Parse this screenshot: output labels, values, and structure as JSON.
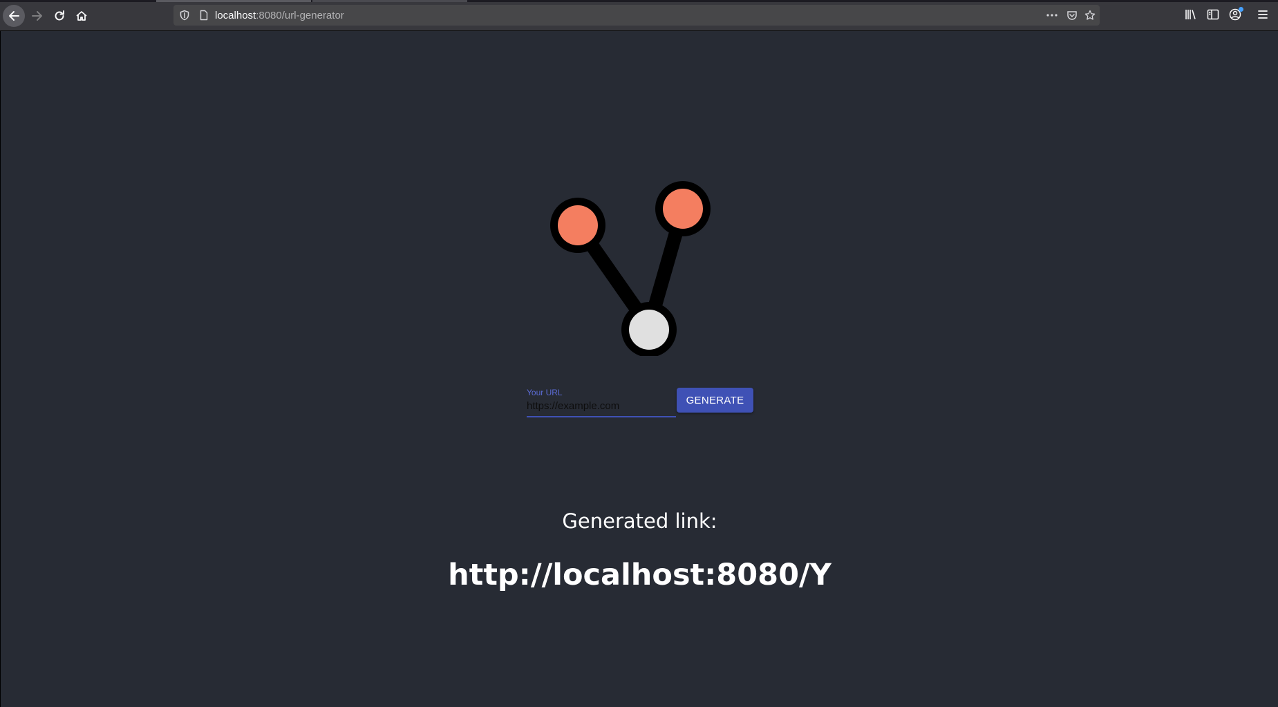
{
  "browser": {
    "url_host": "localhost",
    "url_rest": ":8080/url-generator",
    "icons": {
      "back": "arrow-left-icon",
      "forward": "arrow-right-icon",
      "reload": "reload-icon",
      "home": "home-icon",
      "shield": "shield-icon",
      "page": "page-icon",
      "more": "more-dots-icon",
      "pocket": "pocket-icon",
      "bookmark": "star-icon",
      "library": "library-icon",
      "sidebar": "sidebar-icon",
      "account": "account-icon",
      "menu": "hamburger-menu-icon"
    }
  },
  "logo": {
    "node_colors": {
      "top_left": "#f47e60",
      "top_right": "#f47e60",
      "bottom": "#e0e0e0",
      "ring": "#000000"
    }
  },
  "form": {
    "label": "Your URL",
    "input_value": "https://example.com",
    "button_label": "GENERATE",
    "accent_color": "#3f51b5"
  },
  "result": {
    "label": "Generated link:",
    "link": "http://localhost:8080/Y"
  }
}
